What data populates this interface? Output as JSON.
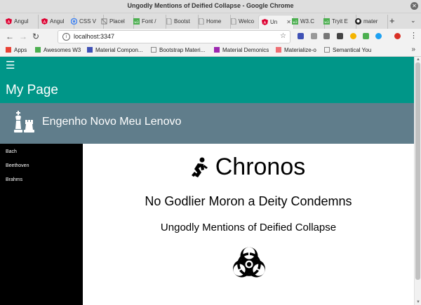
{
  "window": {
    "title": "Ungodly Mentions of Deified Collapse - Google Chrome",
    "close_glyph": "✕"
  },
  "tabs": [
    {
      "label": "Angul",
      "icon": "angular-icon",
      "color": "#dd0031"
    },
    {
      "label": "Angul",
      "icon": "angular-icon",
      "color": "#dd0031"
    },
    {
      "label": "CSS V",
      "icon": "chrome-icon",
      "color": "#4285f4"
    },
    {
      "label": "Placel",
      "icon": "placeholder-icon",
      "color": "#777777"
    },
    {
      "label": "Font /",
      "icon": "w3-icon",
      "color": "#4caf50"
    },
    {
      "label": "Bootst",
      "icon": "page-icon",
      "color": "#888888"
    },
    {
      "label": "Home",
      "icon": "page-icon",
      "color": "#888888"
    },
    {
      "label": "Welco",
      "icon": "page-icon",
      "color": "#888888"
    },
    {
      "label": "Un",
      "icon": "angular-icon",
      "color": "#dd0031",
      "active": true
    },
    {
      "label": "W3.C",
      "icon": "w3-icon",
      "color": "#4caf50"
    },
    {
      "label": "Tryit E",
      "icon": "w3-icon",
      "color": "#4caf50"
    },
    {
      "label": "mater",
      "icon": "github-icon",
      "color": "#222222"
    }
  ],
  "tab_close_glyph": "✕",
  "new_tab_glyph": "+",
  "tab_strip_control_glyph": "⌄",
  "toolbar": {
    "back": "←",
    "forward": "→",
    "reload": "↻",
    "info": "i",
    "star": "☆"
  },
  "address": {
    "url": "localhost:3347"
  },
  "bookmarks": [
    {
      "label": "Apps",
      "icon": "apps-grid-icon",
      "color": "#e94235"
    },
    {
      "label": "Awesomes W3",
      "icon": "w3-icon",
      "color": "#4caf50"
    },
    {
      "label": "Material Compon...",
      "icon": "material-icon",
      "color": "#3f51b5"
    },
    {
      "label": "Bootstrap Materi...",
      "icon": "page-icon",
      "color": "#888888"
    },
    {
      "label": "Material Demonics",
      "icon": "material-icon",
      "color": "#9c27b0"
    },
    {
      "label": "Materialize-o",
      "icon": "materialize-icon",
      "color": "#ee6e73"
    },
    {
      "label": "Semantical You",
      "icon": "page-icon",
      "color": "#888888"
    }
  ],
  "bookmarks_more": "»",
  "app": {
    "menu_glyph": "☰",
    "page_title": "My Page",
    "header_title": "Engenho Novo Meu Lenovo",
    "nav_items": [
      "Bach",
      "Beethoven",
      "Brahms"
    ],
    "content": {
      "heading": "Chronos",
      "heading_icon": "running-person-icon",
      "subheading": "No Godlier Moron a Deity Condemns",
      "tagline": "Ungodly Mentions of Deified Collapse",
      "symbol_icon": "biohazard-icon"
    }
  },
  "colors": {
    "primary": "#009688",
    "header_band": "#607d8b",
    "sidenav": "#000000",
    "text_on_primary": "#ffffff"
  }
}
